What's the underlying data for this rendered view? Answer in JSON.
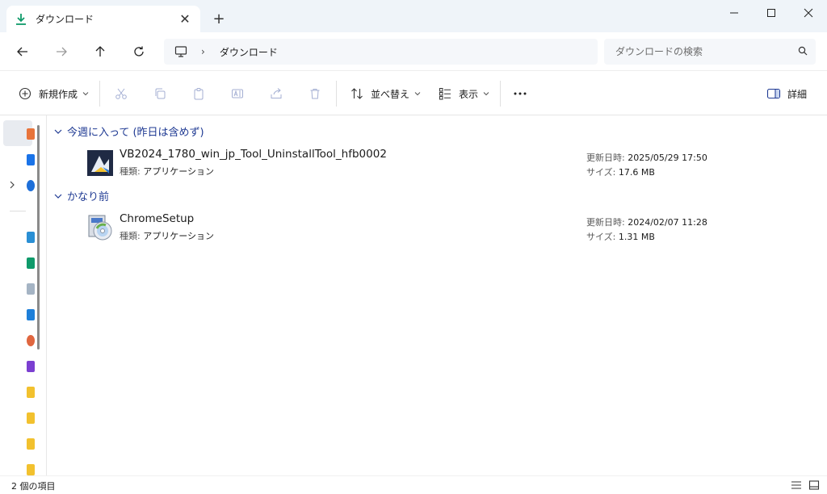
{
  "window": {
    "tab_title": "ダウンロード",
    "tab_icon": "download-icon"
  },
  "navbar": {
    "breadcrumb": [
      "ダウンロード"
    ],
    "search_placeholder": "ダウンロードの検索"
  },
  "commandbar": {
    "new_label": "新規作成",
    "sort_label": "並べ替え",
    "view_label": "表示",
    "more_label": "…",
    "details_label": "詳細"
  },
  "groups": [
    {
      "title": "今週に入って (昨日は含めず)",
      "files": [
        {
          "name": "VB2024_1780_win_jp_Tool_UninstallTool_hfb0002",
          "type_key": "種類:",
          "type_value": "アプリケーション",
          "date_key": "更新日時:",
          "date_value": "2025/05/29 17:50",
          "size_key": "サイズ:",
          "size_value": "17.6 MB"
        }
      ]
    },
    {
      "title": "かなり前",
      "files": [
        {
          "name": "ChromeSetup",
          "type_key": "種類:",
          "type_value": "アプリケーション",
          "date_key": "更新日時:",
          "date_value": "2024/02/07 11:28",
          "size_key": "サイズ:",
          "size_value": "1.31 MB"
        }
      ]
    }
  ],
  "status": {
    "item_count": "2 個の項目"
  },
  "colors": {
    "accent": "#1f3a93",
    "download_green": "#0f7b55"
  }
}
